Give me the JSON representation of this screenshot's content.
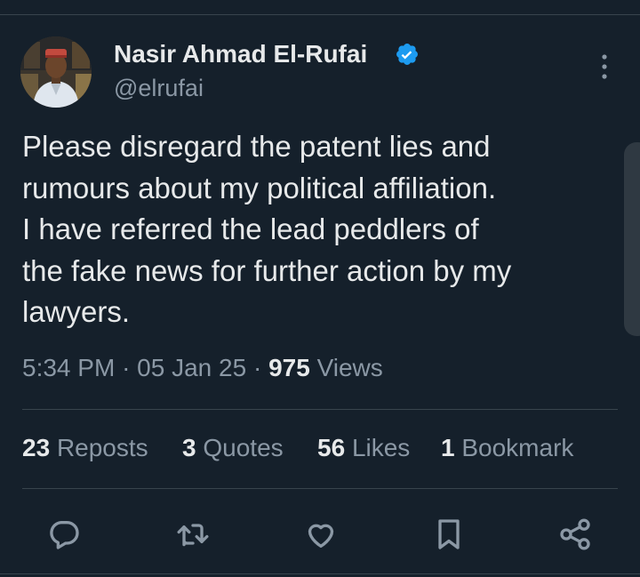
{
  "author": {
    "name": "Nasir Ahmad El-Rufai",
    "handle": "@elrufai",
    "verified": true
  },
  "tweet": {
    "text": "Please disregard the patent lies and\nrumours about my political affiliation.\nI have referred the lead peddlers of\nthe fake news for further action by my\nlawyers."
  },
  "meta": {
    "time": "5:34 PM",
    "separator": "·",
    "date": "05 Jan 25",
    "views_count": "975",
    "views_label": "Views"
  },
  "stats": {
    "reposts": {
      "count": "23",
      "label": "Reposts"
    },
    "quotes": {
      "count": "3",
      "label": "Quotes"
    },
    "likes": {
      "count": "56",
      "label": "Likes"
    },
    "bookmarks": {
      "count": "1",
      "label": "Bookmark"
    }
  },
  "actions": [
    "reply-icon",
    "repost-icon",
    "like-icon",
    "bookmark-icon",
    "share-icon"
  ],
  "colors": {
    "background": "#15202b",
    "text_primary": "#e7e9ea",
    "text_secondary": "#8b98a5",
    "verified_blue": "#1d9bf0",
    "divider": "#38444d"
  }
}
